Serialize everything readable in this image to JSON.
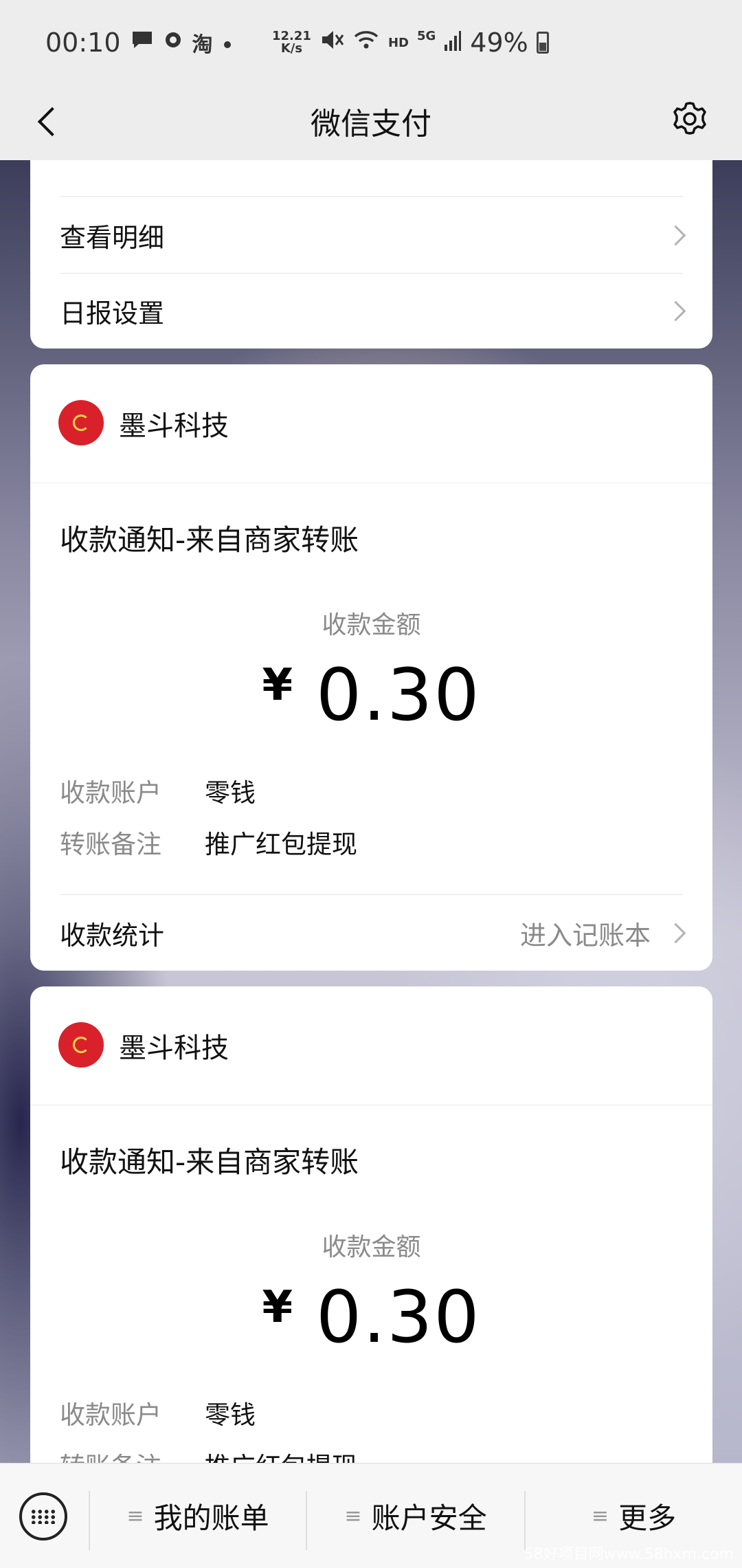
{
  "status_bar": {
    "time": "00:10",
    "notif_icons": [
      "chat-bubble-icon",
      "circle-icon",
      "taobao-icon",
      "dot-icon"
    ],
    "taobao_glyph": "淘",
    "speed_value": "12.21",
    "speed_unit": "K/s",
    "hd": "HD",
    "network": "5G",
    "battery": "49%"
  },
  "nav": {
    "title": "微信支付"
  },
  "menu_card": {
    "items": [
      {
        "label": "查看明细"
      },
      {
        "label": "日报设置"
      }
    ]
  },
  "notifications": [
    {
      "merchant": "墨斗科技",
      "title": "收款通知-来自商家转账",
      "amount_label": "收款金额",
      "currency": "¥",
      "amount": "0.30",
      "account_label": "收款账户",
      "account_value": "零钱",
      "remark_label": "转账备注",
      "remark_value": "推广红包提现",
      "stat_label": "收款统计",
      "stat_link": "进入记账本"
    },
    {
      "merchant": "墨斗科技",
      "title": "收款通知-来自商家转账",
      "amount_label": "收款金额",
      "currency": "¥",
      "amount": "0.30",
      "account_label": "收款账户",
      "account_value": "零钱",
      "remark_label": "转账备注",
      "remark_value": "推广红包提现"
    }
  ],
  "bottom_bar": {
    "tabs": [
      {
        "label": "我的账单"
      },
      {
        "label": "账户安全"
      },
      {
        "label": "更多"
      }
    ],
    "menu_glyph": "≡"
  },
  "watermark": "58好项目网www.58hxm.com"
}
